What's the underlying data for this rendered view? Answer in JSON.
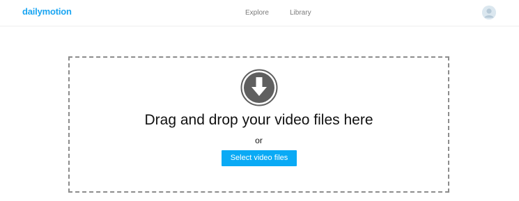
{
  "header": {
    "logo_text": "dailymotion",
    "nav": [
      {
        "label": "Explore"
      },
      {
        "label": "Library"
      }
    ],
    "avatar_icon": "user-avatar-icon"
  },
  "upload": {
    "icon": "download-arrow-icon",
    "headline": "Drag and drop your video files here",
    "separator": "or",
    "button_label": "Select video files"
  },
  "colors": {
    "brand": "#1aa5f2",
    "button": "#0aaaf5",
    "dropzone_border": "#8c8c8c",
    "icon_fill": "#5f5f5f"
  }
}
